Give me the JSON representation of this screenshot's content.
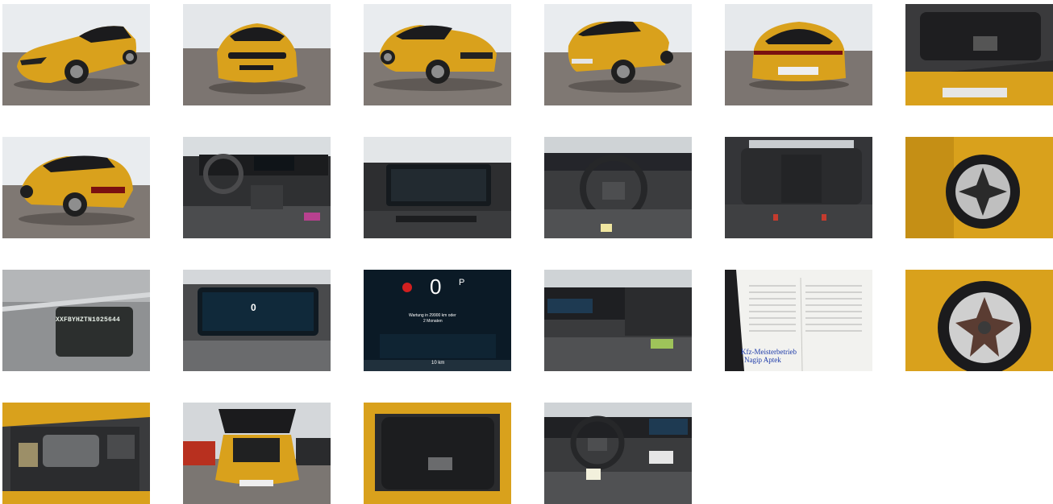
{
  "gallery": {
    "photos": [
      {
        "icon": "car-front-left-photo"
      },
      {
        "icon": "car-front-photo"
      },
      {
        "icon": "car-front-right-photo"
      },
      {
        "icon": "car-rear-right-photo"
      },
      {
        "icon": "car-rear-photo"
      },
      {
        "icon": "trunk-photo"
      },
      {
        "icon": "car-rear-left-photo"
      },
      {
        "icon": "interior-dashboard-photo"
      },
      {
        "icon": "infotainment-screen-photo"
      },
      {
        "icon": "steering-wheel-photo"
      },
      {
        "icon": "rear-seats-photo"
      },
      {
        "icon": "wheel-side-photo"
      },
      {
        "icon": "vin-plate-photo",
        "text": "XXFBYHZTN1025644"
      },
      {
        "icon": "instrument-cluster-photo",
        "text": "0"
      },
      {
        "icon": "speedometer-closeup-photo",
        "speed": "0",
        "gear": "P",
        "msg1": "Wartung in 29900 km oder",
        "msg2": "2 Monaten",
        "odo": "10 km"
      },
      {
        "icon": "front-interior-photo"
      },
      {
        "icon": "service-book-photo",
        "line1": "Kfz-Meisterbetrieb",
        "line2": "Nagip Aptek"
      },
      {
        "icon": "wheel-closeup-photo"
      },
      {
        "icon": "engine-bay-photo"
      },
      {
        "icon": "car-rear-open-trunk-photo"
      },
      {
        "icon": "trunk-floor-photo"
      },
      {
        "icon": "driver-cockpit-photo"
      }
    ]
  },
  "colors": {
    "car_yellow": "#d9a11c",
    "roof_black": "#1b1b1d",
    "studio_wall": "#e9ecef",
    "studio_floor": "#7f7873",
    "interior_dark": "#2f3032"
  }
}
